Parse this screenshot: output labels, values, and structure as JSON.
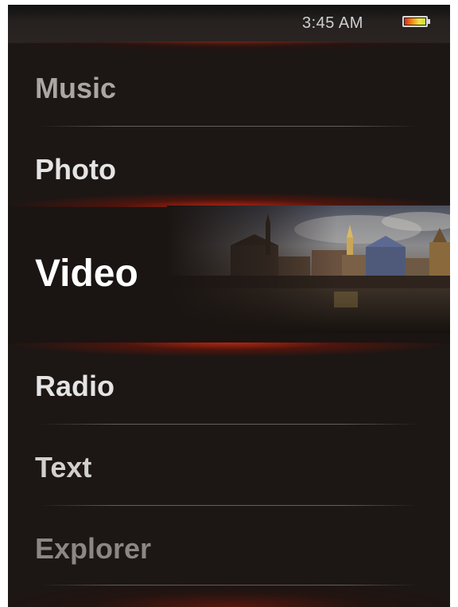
{
  "status_bar": {
    "time": "3:45 AM",
    "battery_icon": "battery-icon"
  },
  "menu": {
    "items": [
      {
        "label": "Music"
      },
      {
        "label": "Photo"
      },
      {
        "label": "Video",
        "selected": true
      },
      {
        "label": "Radio"
      },
      {
        "label": "Text"
      },
      {
        "label": "Explorer"
      }
    ]
  },
  "colors": {
    "background": "#1c1614",
    "selection_glow": "#d2280f",
    "text": "#e4e4e4"
  }
}
